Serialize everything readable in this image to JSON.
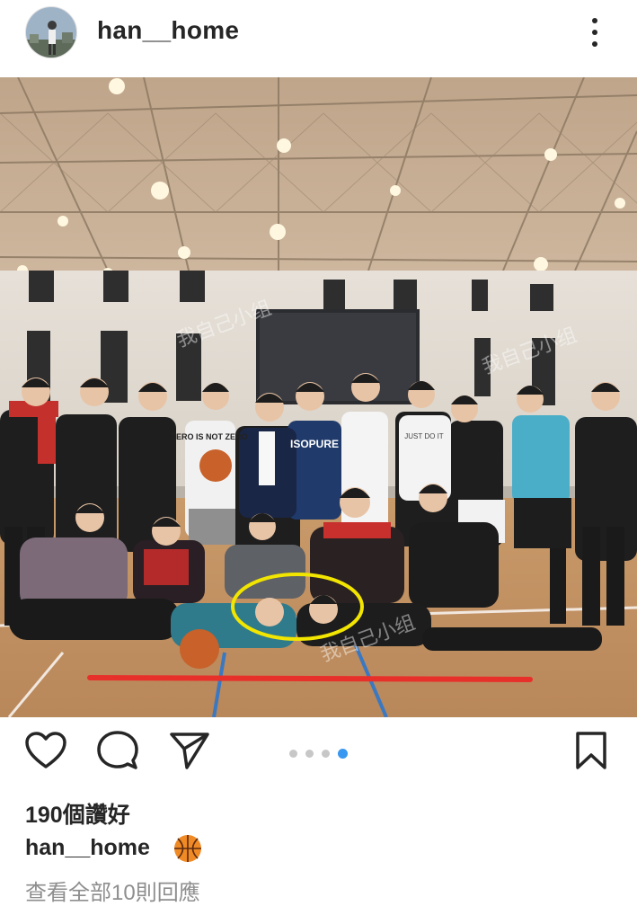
{
  "post": {
    "username": "han__home",
    "likes_text": "190個讚好",
    "caption_username": "han__home",
    "caption_emoji": "basketball-emoji",
    "view_comments_text": "查看全部10則回應"
  },
  "carousel": {
    "total": 4,
    "active_index": 3
  },
  "photo": {
    "scene": "group photo on indoor basketball court",
    "shirt_texts": [
      "ZERO IS NOT ZERO",
      "ISOPURE",
      "JUST DO IT"
    ],
    "watermark_text": "我自己小组",
    "annotations": {
      "highlight_ellipse_color": "#f2e500",
      "underline_color": "#e8302a"
    }
  },
  "icons": {
    "more": "more-vertical-icon",
    "like": "heart-icon",
    "comment": "comment-icon",
    "share": "send-icon",
    "save": "bookmark-icon"
  }
}
